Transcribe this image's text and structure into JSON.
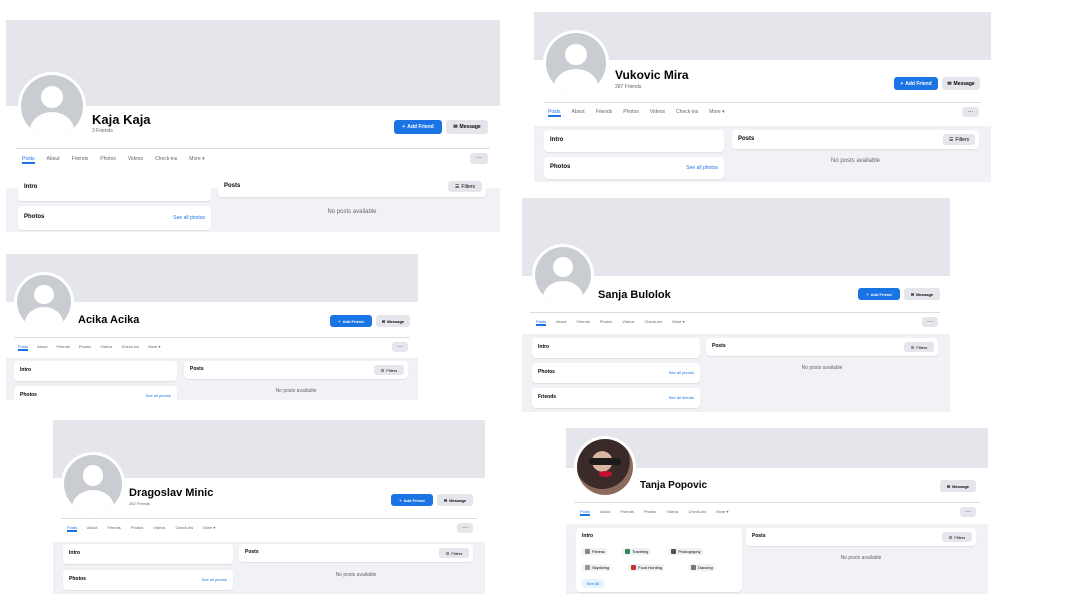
{
  "profiles": [
    {
      "name": "Kaja Kaja",
      "friends": "3 Friends",
      "primary_action": "Add Friend",
      "message": "Message",
      "tabs": [
        "Posts",
        "About",
        "Friends",
        "Photos",
        "Videos",
        "Check-ins",
        "More ▾"
      ],
      "intro": "Intro",
      "photos": "Photos",
      "see_all_photos": "See all photos",
      "posts": "Posts",
      "filters": "Filters",
      "no_posts": "No posts available",
      "more": "···"
    },
    {
      "name": "Vukovic Mira",
      "friends": "287 Friends",
      "primary_action": "Add Friend",
      "message": "Message",
      "tabs": [
        "Posts",
        "About",
        "Friends",
        "Photos",
        "Videos",
        "Check-ins",
        "More ▾"
      ],
      "intro": "Intro",
      "photos": "Photos",
      "see_all_photos": "See all photos",
      "posts": "Posts",
      "filters": "Filters",
      "no_posts": "No posts available",
      "more": "···"
    },
    {
      "name": "Acika Acika",
      "primary_action": "Add Friend",
      "message": "Message",
      "tabs": [
        "Posts",
        "About",
        "Friends",
        "Photos",
        "Videos",
        "Check-ins",
        "More ▾"
      ],
      "intro": "Intro",
      "photos": "Photos",
      "see_all_photos": "See all photos",
      "posts": "Posts",
      "filters": "Filters",
      "no_posts": "No posts available",
      "more": "···"
    },
    {
      "name": "Sanja Bulolok",
      "primary_action": "Add Friend",
      "message": "Message",
      "tabs": [
        "Posts",
        "About",
        "Friends",
        "Photos",
        "Videos",
        "Check-ins",
        "More ▾"
      ],
      "intro": "Intro",
      "photos": "Photos",
      "see_all_photos": "See all photos",
      "friends_label": "Friends",
      "see_all_friends": "See all friends",
      "posts": "Posts",
      "filters": "Filters",
      "no_posts": "No posts available",
      "more": "···"
    },
    {
      "name": "Dragoslav Minic",
      "friends": "282 Friends",
      "primary_action": "Add Friend",
      "message": "Message",
      "tabs": [
        "Posts",
        "About",
        "Friends",
        "Photos",
        "Videos",
        "Check-ins",
        "More ▾"
      ],
      "intro": "Intro",
      "photos": "Photos",
      "see_all_photos": "See all photos",
      "posts": "Posts",
      "filters": "Filters",
      "no_posts": "No posts available",
      "more": "···"
    },
    {
      "name": "Tanja Popovic",
      "message": "Message",
      "tabs": [
        "Posts",
        "About",
        "Friends",
        "Photos",
        "Videos",
        "Check-ins",
        "More ▾"
      ],
      "intro": "Intro",
      "chips": [
        "Fitness",
        "Traveling",
        "Photography",
        "Skydiving",
        "Food Hunting",
        "Dancing"
      ],
      "see_all": "See All",
      "posts": "Posts",
      "filters": "Filters",
      "no_posts": "No posts available",
      "more": "···"
    }
  ],
  "colors": {
    "accent": "#1b74e4",
    "cover": "#e4e6eb",
    "background": "#f0f2f5"
  },
  "icons": {
    "add_friend": "person-add-icon",
    "message": "messenger-icon",
    "filters": "filter-icon"
  }
}
